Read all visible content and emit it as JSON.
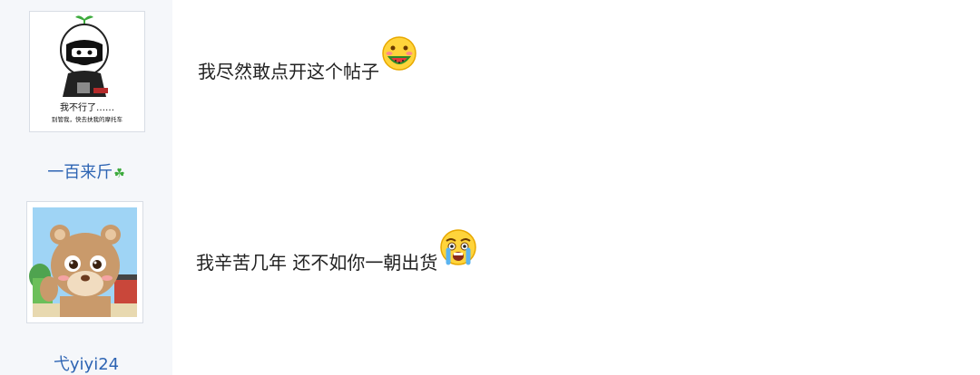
{
  "posts": [
    {
      "avatar": {
        "caption_line1": "我不行了……",
        "caption_line2": "别管我，快去扶我的摩托车"
      },
      "username": "一百来斤",
      "username_icon": "clover-icon",
      "message": "我尽然敢点开这个帖子",
      "emoji": "watermelon-eating-face-emoji"
    },
    {
      "username": "弋yiyi24",
      "message": "我辛苦几年 还不如你一朝出货",
      "emoji": "crying-face-emoji"
    }
  ],
  "colors": {
    "sidebar_bg": "#f5f7fa",
    "username": "#2d64b3",
    "message_text": "#222222"
  }
}
